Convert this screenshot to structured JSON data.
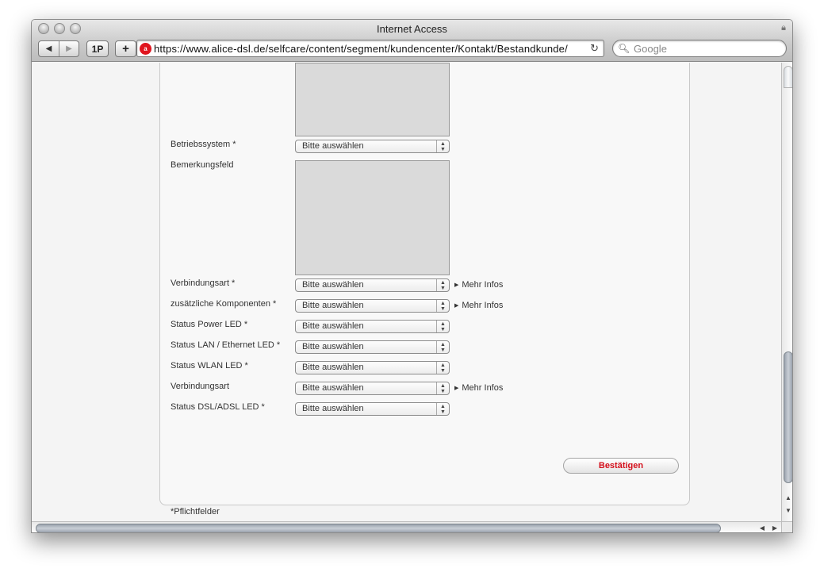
{
  "window": {
    "title": "Internet Access",
    "lock_icon": "lock-icon"
  },
  "toolbar": {
    "back_icon": "back-arrow-icon",
    "forward_icon": "forward-arrow-icon",
    "onepassword_label": "1P",
    "add_label": "+",
    "url": "https://www.alice-dsl.de/selfcare/content/segment/kundencenter/Kontakt/Bestandkunde/",
    "site_icon": "alice-logo-icon",
    "reload_icon": "reload-icon",
    "search_placeholder": "Google"
  },
  "form": {
    "rows": [
      {
        "label": "Betriebssystem *",
        "value": "Bitte auswählen"
      },
      {
        "label": "Bemerkungsfeld"
      },
      {
        "label": "Verbindungsart *",
        "value": "Bitte auswählen",
        "more": "Mehr Infos"
      },
      {
        "label": "zusätzliche Komponenten *",
        "value": "Bitte auswählen",
        "more": "Mehr Infos"
      },
      {
        "label": "Status Power LED *",
        "value": "Bitte auswählen"
      },
      {
        "label": "Status LAN / Ethernet LED *",
        "value": "Bitte auswählen"
      },
      {
        "label": "Status WLAN LED *",
        "value": "Bitte auswählen"
      },
      {
        "label": "Verbindungsart",
        "value": "Bitte auswählen",
        "more": "Mehr Infos"
      },
      {
        "label": "Status DSL/ADSL LED *",
        "value": "Bitte auswählen"
      }
    ],
    "submit_label": "Bestätigen",
    "footnote": "*Pflichtfelder"
  },
  "colors": {
    "accent": "#d40f1b",
    "textarea_bg": "#dadada"
  }
}
